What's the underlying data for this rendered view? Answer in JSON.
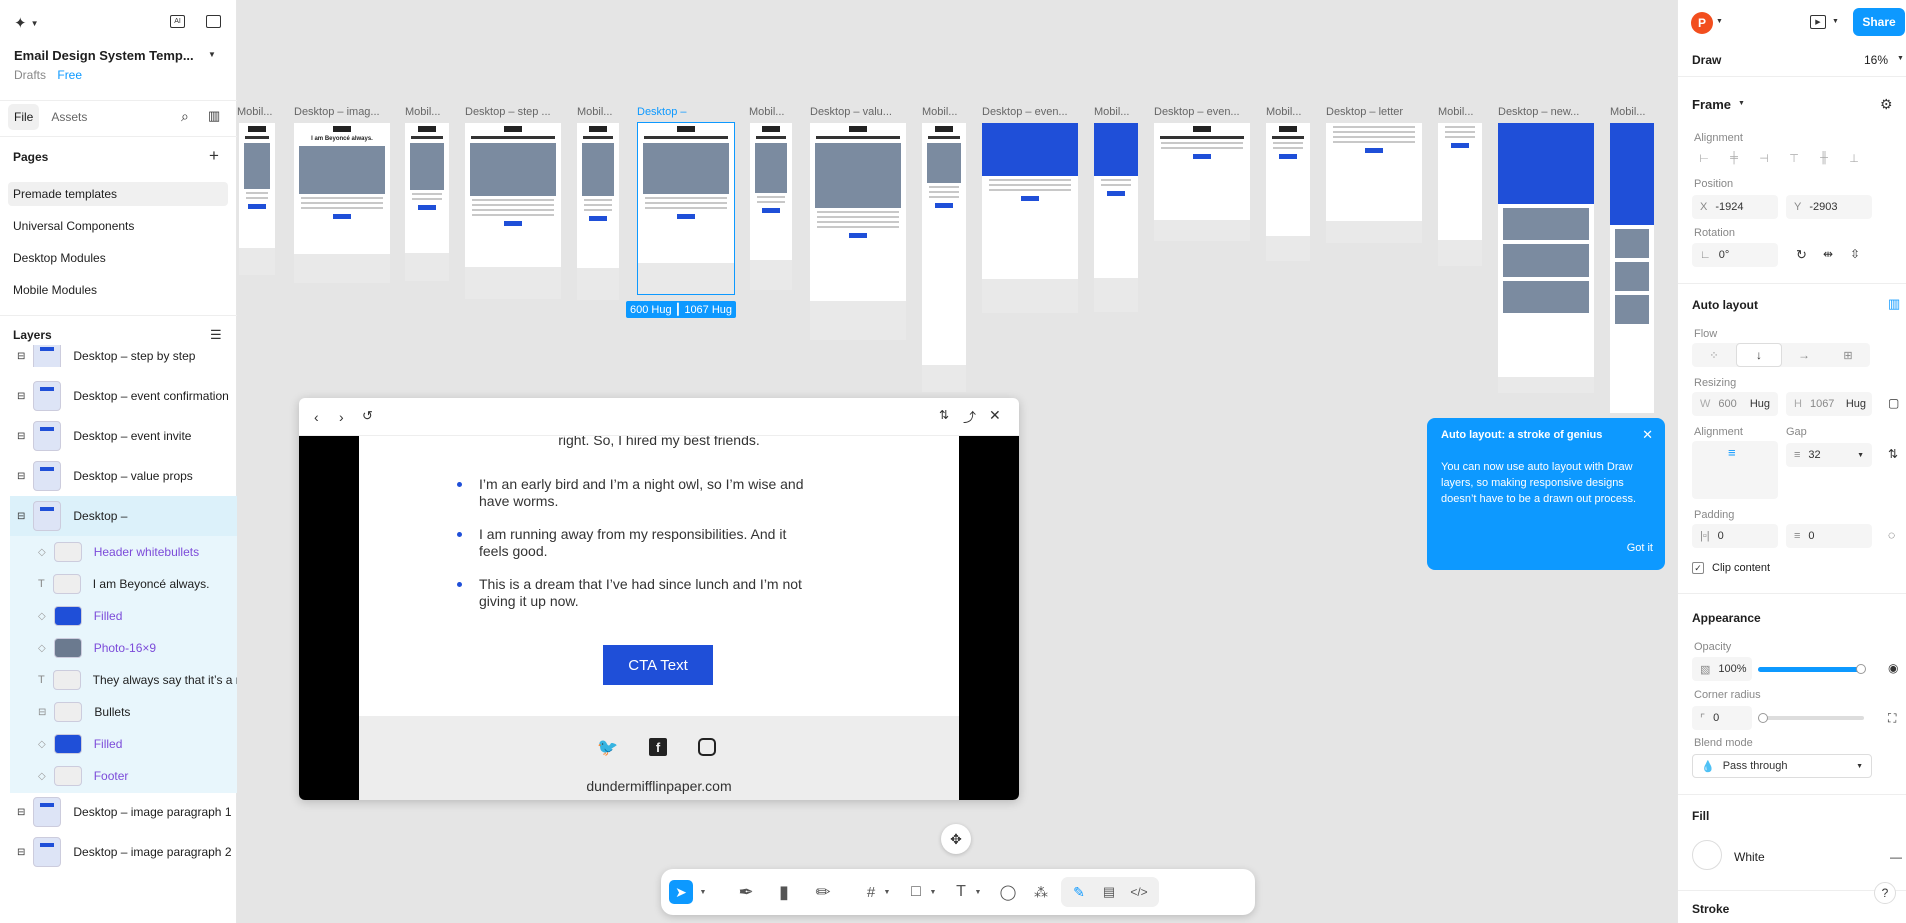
{
  "file": {
    "title": "Email Design System Temp...",
    "location": "Drafts",
    "plan": "Free"
  },
  "left_tabs": [
    "File",
    "Assets"
  ],
  "pages_label": "Pages",
  "pages": [
    "Premade templates",
    "Universal Components",
    "Desktop Modules",
    "Mobile Modules"
  ],
  "layers_label": "Layers",
  "layers": [
    {
      "label": "Desktop – step by step"
    },
    {
      "label": "Desktop – event confirmation"
    },
    {
      "label": "Desktop – event invite"
    },
    {
      "label": "Desktop – value props"
    },
    {
      "label": "Desktop –"
    },
    {
      "label": "Header whitebullets"
    },
    {
      "label": "I am Beyoncé always."
    },
    {
      "label": "Filled"
    },
    {
      "label": "Photo-16×9"
    },
    {
      "label": "They always say that it’s a r"
    },
    {
      "label": "Bullets"
    },
    {
      "label": "Filled"
    },
    {
      "label": "Footer"
    },
    {
      "label": "Desktop – image paragraph 1"
    },
    {
      "label": "Desktop – image paragraph 2"
    }
  ],
  "frame_titles": [
    "Mobil...",
    "Desktop – imag...",
    "Mobil...",
    "Desktop – step ...",
    "Mobil...",
    "Desktop –",
    "Mobil...",
    "Desktop – valu...",
    "Mobil...",
    "Desktop – even...",
    "Mobil...",
    "Desktop – even...",
    "Mobil...",
    "Desktop – letter",
    "Mobil...",
    "Desktop – new...",
    "Mobil..."
  ],
  "frame_heading": "I am Beyoncé always.",
  "size_badge": "600 Hug ┃ 1067 Hug",
  "preview": {
    "cut_text": "right. So, I hired my best friends.",
    "bullets": [
      "I’m an early bird and I’m a night owl, so I’m wise and have worms.",
      "I am running away from my responsibilities. And it feels good.",
      "This is a dream that I’ve had since lunch and I’m not giving it up now."
    ],
    "cta": "CTA Text",
    "site": "dundermifflinpaper.com"
  },
  "tooltip": {
    "title": "Auto layout: a stroke of genius",
    "body": "You can now use auto layout with Draw layers, so making responsive designs doesn’t have to be a drawn out process.",
    "button": "Got it"
  },
  "right": {
    "avatar": "P",
    "share": "Share",
    "mode": "Draw",
    "zoom": "16%",
    "frame_label": "Frame",
    "alignment": "Alignment",
    "position": "Position",
    "x": "-1924",
    "y": "-2903",
    "x_label": "X",
    "y_label": "Y",
    "rotation": "Rotation",
    "rotation_val": "0°",
    "auto_layout": "Auto layout",
    "flow": "Flow",
    "resizing": "Resizing",
    "w_label": "W",
    "w": "600",
    "w_mode": "Hug",
    "h_label": "H",
    "h": "1067",
    "h_mode": "Hug",
    "alignment2": "Alignment",
    "gap": "Gap",
    "gap_val": "32",
    "padding": "Padding",
    "pad_h": "0",
    "pad_v": "0",
    "clip": "Clip content",
    "appearance": "Appearance",
    "opacity": "Opacity",
    "opacity_val": "100%",
    "opacity_level": 0.97,
    "radius": "Corner radius",
    "radius_val": "0",
    "blend": "Blend mode",
    "blend_val": "Pass through",
    "fill": "Fill",
    "fill_val": "White",
    "stroke": "Stroke"
  }
}
